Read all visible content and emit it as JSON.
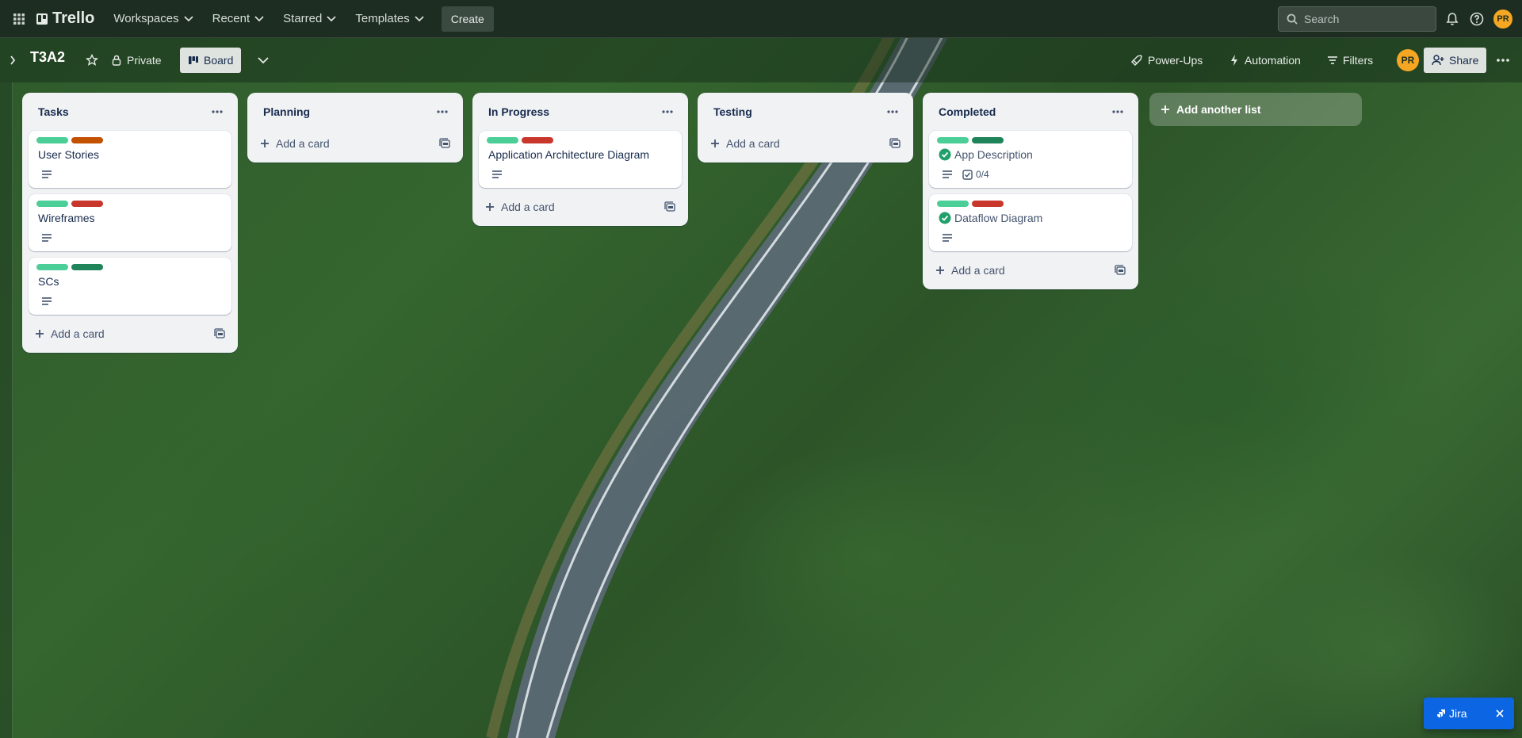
{
  "topnav": {
    "brand": "Trello",
    "workspaces": "Workspaces",
    "recent": "Recent",
    "starred": "Starred",
    "templates": "Templates",
    "create": "Create",
    "search_placeholder": "Search",
    "avatar_initials": "PR"
  },
  "board": {
    "title": "T3A2",
    "visibility": "Private",
    "view": "Board",
    "power_ups": "Power-Ups",
    "automation": "Automation",
    "filters": "Filters",
    "share": "Share",
    "member_initials": "PR"
  },
  "label_colors": {
    "green": "#4bce97",
    "orange": "#c25100",
    "red": "#c9372c",
    "dark_green": "#1f845a"
  },
  "lists": [
    {
      "title": "Tasks",
      "cards": [
        {
          "title": "User Stories",
          "labels": [
            "green",
            "orange"
          ],
          "has_description": true
        },
        {
          "title": "Wireframes",
          "labels": [
            "green",
            "red"
          ],
          "has_description": true
        },
        {
          "title": "SCs",
          "labels": [
            "green",
            "dark_green"
          ],
          "has_description": true
        }
      ],
      "add_card": "Add a card"
    },
    {
      "title": "Planning",
      "cards": [],
      "add_card": "Add a card"
    },
    {
      "title": "In Progress",
      "cards": [
        {
          "title": "Application Architecture Diagram",
          "labels": [
            "green",
            "red"
          ],
          "has_description": true
        }
      ],
      "add_card": "Add a card"
    },
    {
      "title": "Testing",
      "cards": [],
      "add_card": "Add a card"
    },
    {
      "title": "Completed",
      "cards": [
        {
          "title": "App Description",
          "labels": [
            "green",
            "dark_green"
          ],
          "has_description": true,
          "complete": true,
          "checklist": "0/4"
        },
        {
          "title": "Dataflow Diagram",
          "labels": [
            "green",
            "red"
          ],
          "has_description": true,
          "complete": true
        }
      ],
      "add_card": "Add a card"
    }
  ],
  "add_list": "Add another list",
  "jira_button": "Jira"
}
